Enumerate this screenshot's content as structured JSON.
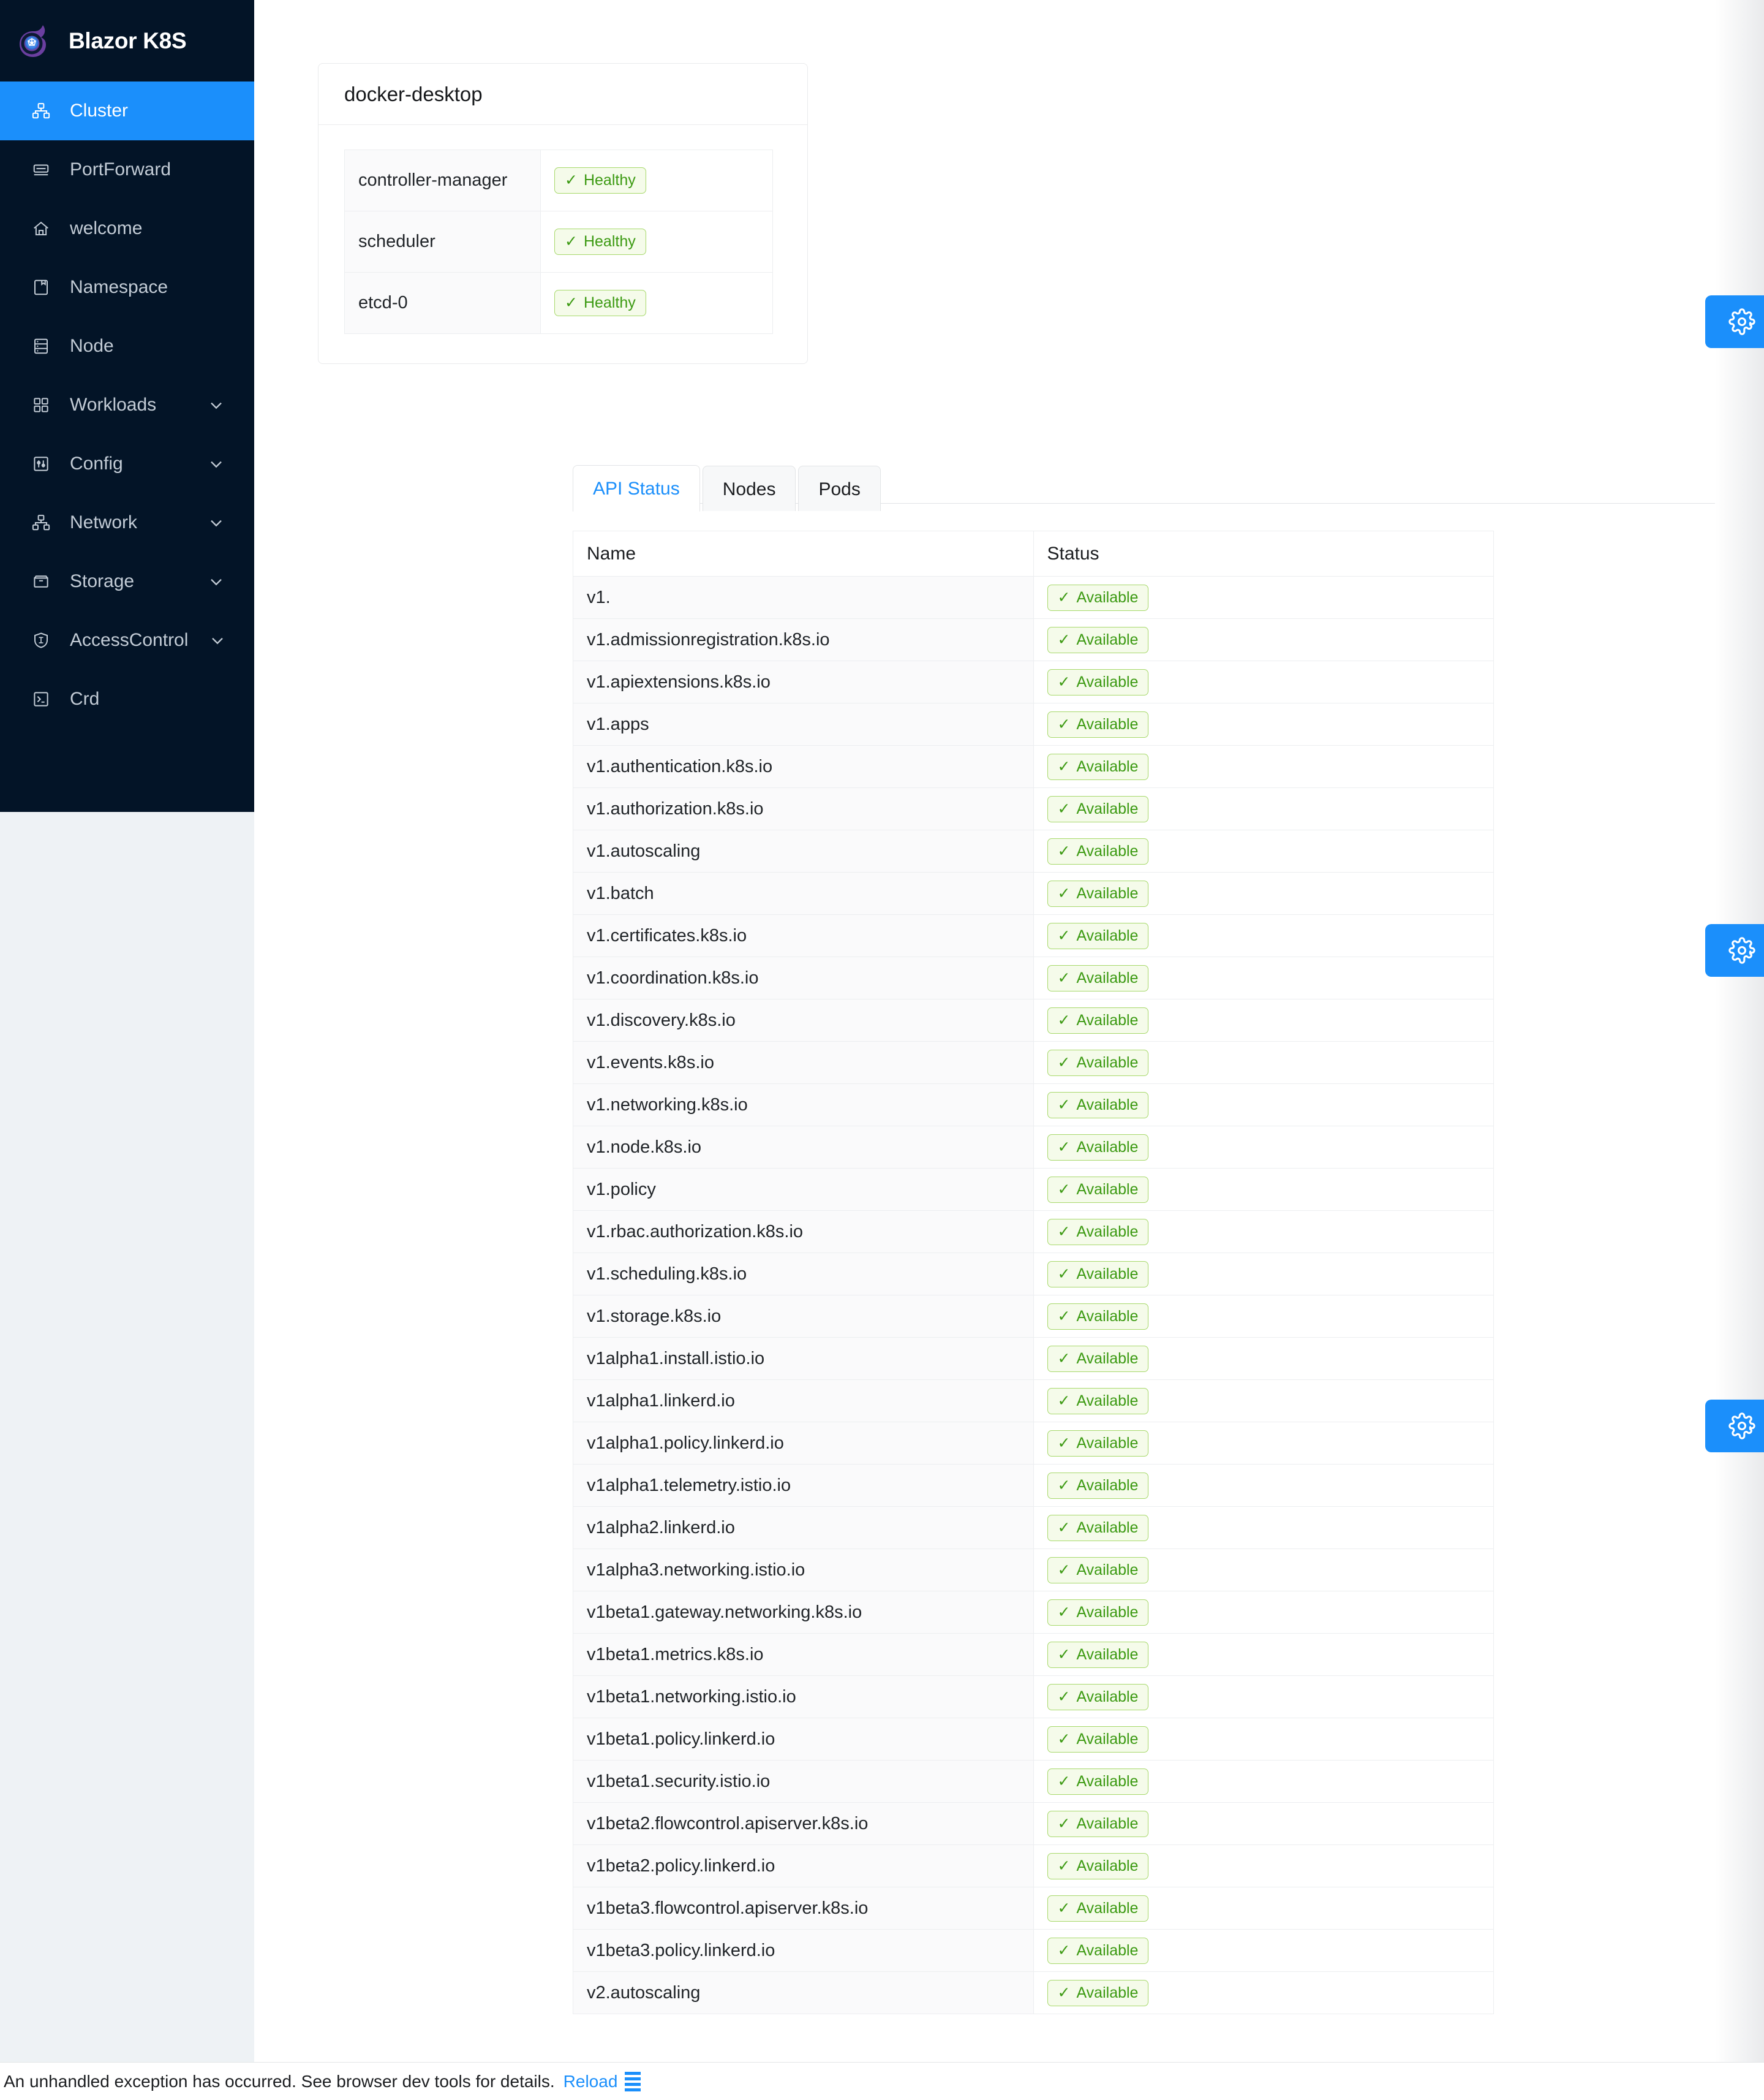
{
  "app": {
    "brand_title": "Blazor K8S",
    "logo_icon": "blazor-kubernetes-logo"
  },
  "sidebar": {
    "items": [
      {
        "label": "Cluster",
        "icon": "cluster-icon",
        "active": true,
        "expandable": false
      },
      {
        "label": "PortForward",
        "icon": "portforward-icon",
        "active": false,
        "expandable": false
      },
      {
        "label": "welcome",
        "icon": "home-icon",
        "active": false,
        "expandable": false
      },
      {
        "label": "Namespace",
        "icon": "namespace-icon",
        "active": false,
        "expandable": false
      },
      {
        "label": "Node",
        "icon": "node-icon",
        "active": false,
        "expandable": false
      },
      {
        "label": "Workloads",
        "icon": "workloads-icon",
        "active": false,
        "expandable": true
      },
      {
        "label": "Config",
        "icon": "config-icon",
        "active": false,
        "expandable": true
      },
      {
        "label": "Network",
        "icon": "network-icon",
        "active": false,
        "expandable": true
      },
      {
        "label": "Storage",
        "icon": "storage-icon",
        "active": false,
        "expandable": true
      },
      {
        "label": "AccessControl",
        "icon": "shield-icon",
        "active": false,
        "expandable": true
      },
      {
        "label": "Crd",
        "icon": "terminal-icon",
        "active": false,
        "expandable": false
      }
    ]
  },
  "cluster_card": {
    "title": "docker-desktop",
    "components": [
      {
        "name": "controller-manager",
        "status": "Healthy"
      },
      {
        "name": "scheduler",
        "status": "Healthy"
      },
      {
        "name": "etcd-0",
        "status": "Healthy"
      }
    ]
  },
  "tabs": [
    {
      "label": "API Status",
      "active": true
    },
    {
      "label": "Nodes",
      "active": false
    },
    {
      "label": "Pods",
      "active": false
    }
  ],
  "api_table": {
    "columns": [
      "Name",
      "Status"
    ],
    "rows": [
      {
        "name": "v1.",
        "status": "Available"
      },
      {
        "name": "v1.admissionregistration.k8s.io",
        "status": "Available"
      },
      {
        "name": "v1.apiextensions.k8s.io",
        "status": "Available"
      },
      {
        "name": "v1.apps",
        "status": "Available"
      },
      {
        "name": "v1.authentication.k8s.io",
        "status": "Available"
      },
      {
        "name": "v1.authorization.k8s.io",
        "status": "Available"
      },
      {
        "name": "v1.autoscaling",
        "status": "Available"
      },
      {
        "name": "v1.batch",
        "status": "Available"
      },
      {
        "name": "v1.certificates.k8s.io",
        "status": "Available"
      },
      {
        "name": "v1.coordination.k8s.io",
        "status": "Available"
      },
      {
        "name": "v1.discovery.k8s.io",
        "status": "Available"
      },
      {
        "name": "v1.events.k8s.io",
        "status": "Available"
      },
      {
        "name": "v1.networking.k8s.io",
        "status": "Available"
      },
      {
        "name": "v1.node.k8s.io",
        "status": "Available"
      },
      {
        "name": "v1.policy",
        "status": "Available"
      },
      {
        "name": "v1.rbac.authorization.k8s.io",
        "status": "Available"
      },
      {
        "name": "v1.scheduling.k8s.io",
        "status": "Available"
      },
      {
        "name": "v1.storage.k8s.io",
        "status": "Available"
      },
      {
        "name": "v1alpha1.install.istio.io",
        "status": "Available"
      },
      {
        "name": "v1alpha1.linkerd.io",
        "status": "Available"
      },
      {
        "name": "v1alpha1.policy.linkerd.io",
        "status": "Available"
      },
      {
        "name": "v1alpha1.telemetry.istio.io",
        "status": "Available"
      },
      {
        "name": "v1alpha2.linkerd.io",
        "status": "Available"
      },
      {
        "name": "v1alpha3.networking.istio.io",
        "status": "Available"
      },
      {
        "name": "v1beta1.gateway.networking.k8s.io",
        "status": "Available"
      },
      {
        "name": "v1beta1.metrics.k8s.io",
        "status": "Available"
      },
      {
        "name": "v1beta1.networking.istio.io",
        "status": "Available"
      },
      {
        "name": "v1beta1.policy.linkerd.io",
        "status": "Available"
      },
      {
        "name": "v1beta1.security.istio.io",
        "status": "Available"
      },
      {
        "name": "v1beta2.flowcontrol.apiserver.k8s.io",
        "status": "Available"
      },
      {
        "name": "v1beta2.policy.linkerd.io",
        "status": "Available"
      },
      {
        "name": "v1beta3.flowcontrol.apiserver.k8s.io",
        "status": "Available"
      },
      {
        "name": "v1beta3.policy.linkerd.io",
        "status": "Available"
      },
      {
        "name": "v2.autoscaling",
        "status": "Available"
      }
    ]
  },
  "floating_buttons": [
    {
      "icon": "gear-icon"
    },
    {
      "icon": "gear-icon"
    },
    {
      "icon": "gear-icon"
    }
  ],
  "error_bar": {
    "message": "An unhandled exception has occurred. See browser dev tools for details.",
    "reload_label": "Reload",
    "dismiss_icon": "dismiss-icon"
  },
  "colors": {
    "sidebar_bg": "#031427",
    "accent": "#1b8ffb",
    "status_green_text": "#3c9a12",
    "status_green_border": "#a7d96b",
    "status_green_bg": "#f5fbea"
  }
}
